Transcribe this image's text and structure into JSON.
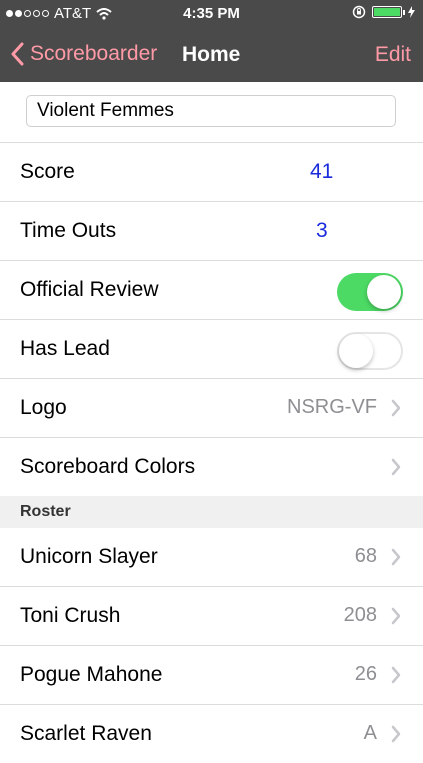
{
  "status_bar": {
    "carrier": "AT&T",
    "time": "4:35 PM",
    "signal_bars_filled": 2,
    "signal_bars_total": 5,
    "battery_level": 1.0,
    "battery_color": "#4cd964"
  },
  "nav": {
    "back_label": "Scoreboarder",
    "title": "Home",
    "edit_label": "Edit",
    "accent_color": "#ff9aa6"
  },
  "team_name": "Violent Femmes",
  "rows": {
    "score": {
      "label": "Score",
      "value": "41"
    },
    "timeouts": {
      "label": "Time Outs",
      "value": "3"
    },
    "official_review": {
      "label": "Official Review",
      "on": true
    },
    "has_lead": {
      "label": "Has Lead",
      "on": false
    },
    "logo": {
      "label": "Logo",
      "value": "NSRG-VF"
    },
    "colors": {
      "label": "Scoreboard Colors"
    }
  },
  "roster": {
    "header": "Roster",
    "players": [
      {
        "name": "Unicorn Slayer",
        "number": "68"
      },
      {
        "name": "Toni Crush",
        "number": "208"
      },
      {
        "name": "Pogue Mahone",
        "number": "26"
      },
      {
        "name": "Scarlet Raven",
        "number": "A"
      }
    ]
  }
}
